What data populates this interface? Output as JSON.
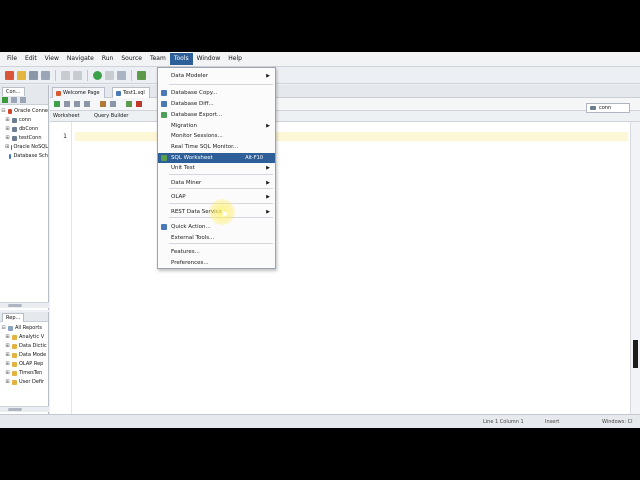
{
  "menubar": {
    "items": [
      "File",
      "Edit",
      "View",
      "Navigate",
      "Run",
      "Source",
      "Team",
      "Tools",
      "Window",
      "Help"
    ],
    "active": "Tools"
  },
  "left_panel": {
    "tab": "Con...",
    "tree": [
      {
        "label": "Oracle Conne",
        "expander": "⊟",
        "color": "#d6442c"
      },
      {
        "label": "conn",
        "expander": "⊞",
        "color": "#6b7c93"
      },
      {
        "label": "dbConn",
        "expander": "⊞",
        "color": "#6b7c93"
      },
      {
        "label": "testConn",
        "expander": "⊞",
        "color": "#6b7c93"
      },
      {
        "label": "Oracle NoSQL",
        "expander": "⊞",
        "color": "#d6442c"
      },
      {
        "label": "Database Sch",
        "expander": "",
        "color": "#3a78c4"
      }
    ]
  },
  "reports_panel": {
    "tab": "Rep...",
    "tree": [
      {
        "label": "All Reports",
        "expander": "⊟",
        "color": "#8aa1bf"
      },
      {
        "label": "Analytic V",
        "expander": "⊞",
        "color": "#e0b342"
      },
      {
        "label": "Data Dictic",
        "expander": "⊞",
        "color": "#e0b342"
      },
      {
        "label": "Data Mode",
        "expander": "⊞",
        "color": "#e0b342"
      },
      {
        "label": "OLAP Rep",
        "expander": "⊞",
        "color": "#e0b342"
      },
      {
        "label": "TimesTen",
        "expander": "⊞",
        "color": "#e0b342"
      },
      {
        "label": "User Defir",
        "expander": "⊞",
        "color": "#e0b342"
      }
    ]
  },
  "doc_tabs": [
    "Welcome Page",
    "Test1.sql"
  ],
  "sub_tabs": [
    "Worksheet",
    "Query Builder"
  ],
  "connection": "conn",
  "editor": {
    "line_number": "1"
  },
  "status": {
    "position": "Line 1 Column 1",
    "mode": "Insert",
    "os": "Windows: Cl"
  },
  "tools_menu": {
    "items": [
      {
        "label": "Data Modeler",
        "submenu": true
      },
      {
        "label": "Database Copy...",
        "icon": "#4a79b8"
      },
      {
        "label": "Database Diff...",
        "icon": "#4a79b8"
      },
      {
        "label": "Database Export...",
        "icon": "#4aa05a"
      },
      {
        "label": "Migration",
        "submenu": true
      },
      {
        "label": "Monitor Sessions..."
      },
      {
        "label": "Real Time SQL Monitor..."
      },
      {
        "label": "SQL Worksheet",
        "accel": "Alt-F10",
        "icon": "#5aa04a",
        "highlighted": true
      },
      {
        "label": "Unit Test",
        "submenu": true
      },
      {
        "label": "Data Miner",
        "submenu": true
      },
      {
        "label": "OLAP",
        "submenu": true
      },
      {
        "label": "REST Data Services",
        "submenu": true
      },
      {
        "label": "Quick Action...",
        "icon": "#4a79b8"
      },
      {
        "label": "External Tools..."
      },
      {
        "label": "Features..."
      },
      {
        "label": "Preferences..."
      }
    ]
  },
  "colors": {
    "accent": "#2f5f98",
    "current_line": "#fdf7d6"
  }
}
